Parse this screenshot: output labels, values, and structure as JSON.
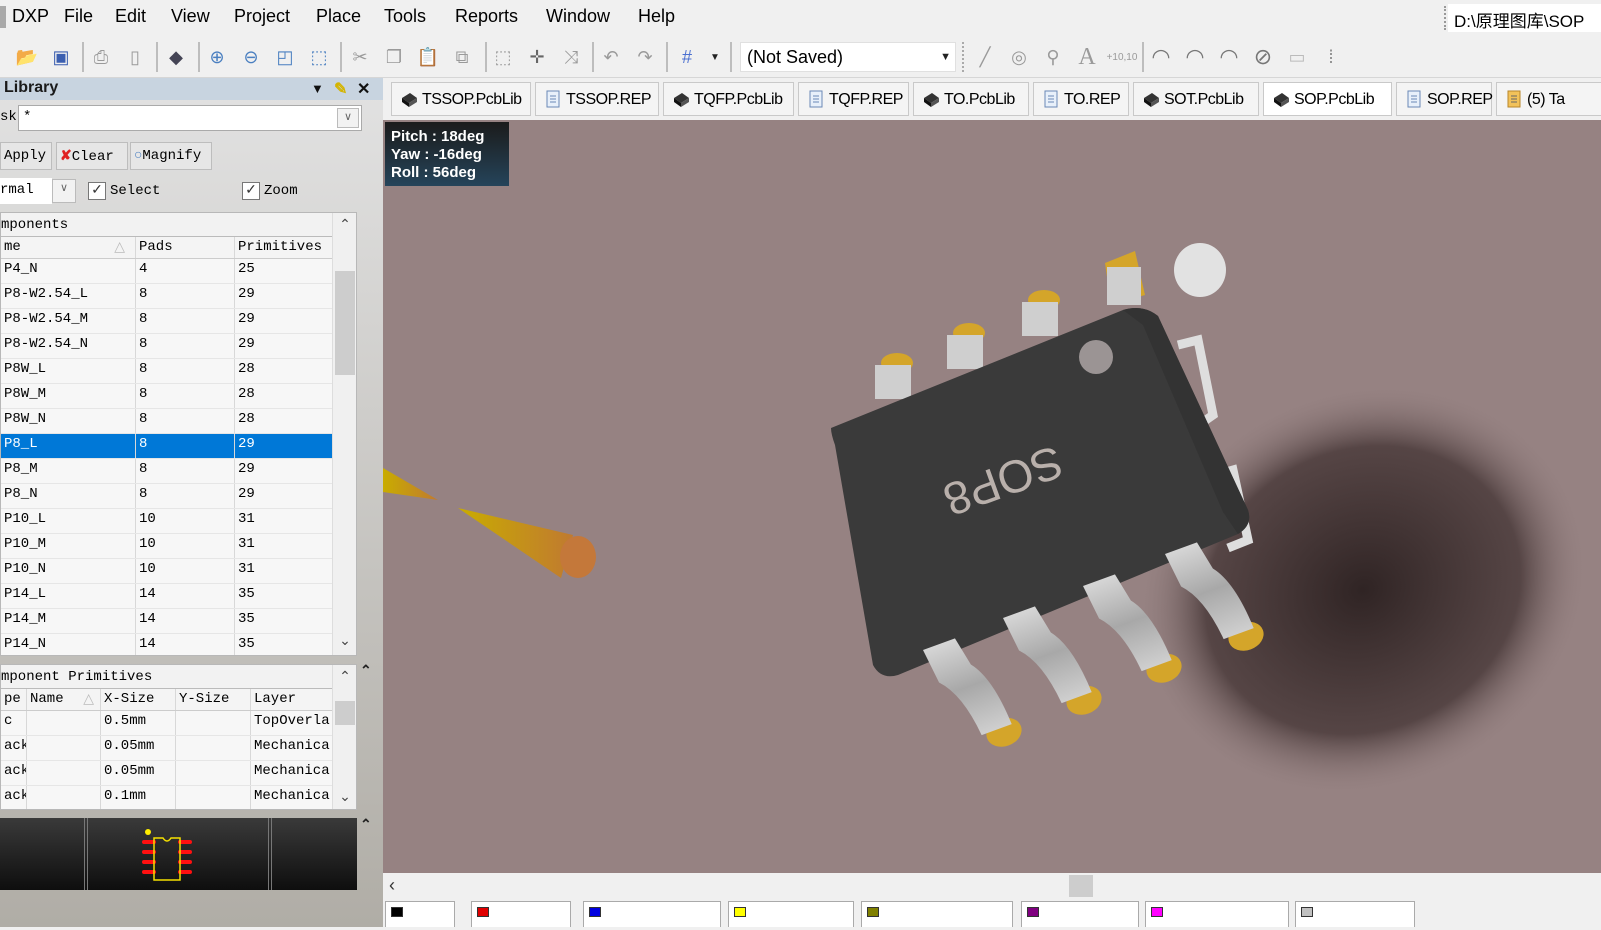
{
  "menubar": {
    "items": [
      "DXP",
      "File",
      "Edit",
      "View",
      "Project",
      "Place",
      "Tools",
      "Reports",
      "Window",
      "Help"
    ],
    "path": "D:\\原理图库\\SOP"
  },
  "toolbar": {
    "combo_value": "(Not Saved)",
    "icons": [
      "open-folder-icon",
      "save-icon",
      "print-icon",
      "print-preview-icon",
      "3d-layer-icon",
      "zoom-in-icon",
      "zoom-out-icon",
      "zoom-fit-icon",
      "zoom-selection-icon",
      "cut-icon",
      "copy-icon",
      "paste-icon",
      "rubber-stamp-icon",
      "select-area-icon",
      "move-icon",
      "deselect-icon",
      "undo-icon",
      "redo-icon",
      "grid-icon",
      "line-icon",
      "pad-icon",
      "via-icon",
      "text-icon",
      "coordinate-icon",
      "arc-center-icon",
      "arc-edge-icon",
      "arc-any-icon",
      "full-circle-icon",
      "fill-icon",
      "array-paste-icon"
    ],
    "coordinate_label": "+10,10"
  },
  "library_panel": {
    "title": "Library",
    "mask_label": "sk",
    "mask_value": "*",
    "apply_label": "Apply",
    "clear_label": "Clear",
    "magnify_label": "Magnify",
    "mode_value": "rmal",
    "select_label": "Select",
    "select_checked": true,
    "zoom_label": "Zoom",
    "zoom_checked": true,
    "components": {
      "caption": "mponents",
      "headers": [
        "me",
        "Pads",
        "Primitives"
      ],
      "rows": [
        {
          "name": "P4_N",
          "pads": "4",
          "primitives": "25"
        },
        {
          "name": "P8-W2.54_L",
          "pads": "8",
          "primitives": "29"
        },
        {
          "name": "P8-W2.54_M",
          "pads": "8",
          "primitives": "29"
        },
        {
          "name": "P8-W2.54_N",
          "pads": "8",
          "primitives": "29"
        },
        {
          "name": "P8W_L",
          "pads": "8",
          "primitives": "28"
        },
        {
          "name": "P8W_M",
          "pads": "8",
          "primitives": "28"
        },
        {
          "name": "P8W_N",
          "pads": "8",
          "primitives": "28"
        },
        {
          "name": "P8_L",
          "pads": "8",
          "primitives": "29",
          "selected": true
        },
        {
          "name": "P8_M",
          "pads": "8",
          "primitives": "29"
        },
        {
          "name": "P8_N",
          "pads": "8",
          "primitives": "29"
        },
        {
          "name": "P10_L",
          "pads": "10",
          "primitives": "31"
        },
        {
          "name": "P10_M",
          "pads": "10",
          "primitives": "31"
        },
        {
          "name": "P10_N",
          "pads": "10",
          "primitives": "31"
        },
        {
          "name": "P14_L",
          "pads": "14",
          "primitives": "35"
        },
        {
          "name": "P14_M",
          "pads": "14",
          "primitives": "35"
        },
        {
          "name": "P14_N",
          "pads": "14",
          "primitives": "35"
        }
      ]
    },
    "primitives": {
      "caption": "mponent Primitives",
      "headers": [
        "pe",
        "Name",
        "X-Size",
        "Y-Size",
        "Layer"
      ],
      "rows": [
        {
          "type": "c",
          "name": "",
          "xsize": "0.5mm",
          "ysize": "",
          "layer": "TopOverla"
        },
        {
          "type": "ack",
          "name": "",
          "xsize": "0.05mm",
          "ysize": "",
          "layer": "Mechanica"
        },
        {
          "type": "ack",
          "name": "",
          "xsize": "0.05mm",
          "ysize": "",
          "layer": "Mechanica"
        },
        {
          "type": "ack",
          "name": "",
          "xsize": "0.1mm",
          "ysize": "",
          "layer": "Mechanica"
        }
      ]
    }
  },
  "doc_tabs": [
    {
      "label": "TSSOP.PcbLib",
      "icon": "pcblib-icon"
    },
    {
      "label": "TSSOP.REP",
      "icon": "document-icon"
    },
    {
      "label": "TQFP.PcbLib",
      "icon": "pcblib-icon"
    },
    {
      "label": "TQFP.REP",
      "icon": "document-icon"
    },
    {
      "label": "TO.PcbLib",
      "icon": "pcblib-icon"
    },
    {
      "label": "TO.REP",
      "icon": "document-icon"
    },
    {
      "label": "SOT.PcbLib",
      "icon": "pcblib-icon"
    },
    {
      "label": "SOP.PcbLib",
      "icon": "pcblib-icon",
      "active": true
    },
    {
      "label": "SOP.REP",
      "icon": "document-icon"
    },
    {
      "label": "(5) Ta",
      "icon": "notes-icon"
    }
  ],
  "view3d": {
    "pitch": "Pitch : 18deg",
    "yaw": "Yaw : -16deg",
    "roll": "Roll : 56deg",
    "chip_marking": "SOP8",
    "background_color": "#968282",
    "body_color": "#3a3a3a",
    "pad_color": "#d4a52a",
    "lead_color": "#c8c8c8"
  },
  "layer_tabs": [
    {
      "color": "#000000"
    },
    {
      "color": "#e00000"
    },
    {
      "color": "#0000e0"
    },
    {
      "color": "#ffff00"
    },
    {
      "color": "#808000"
    },
    {
      "color": "#800080"
    },
    {
      "color": "#ff00ff"
    },
    {
      "color": "#c0c0c0"
    }
  ]
}
